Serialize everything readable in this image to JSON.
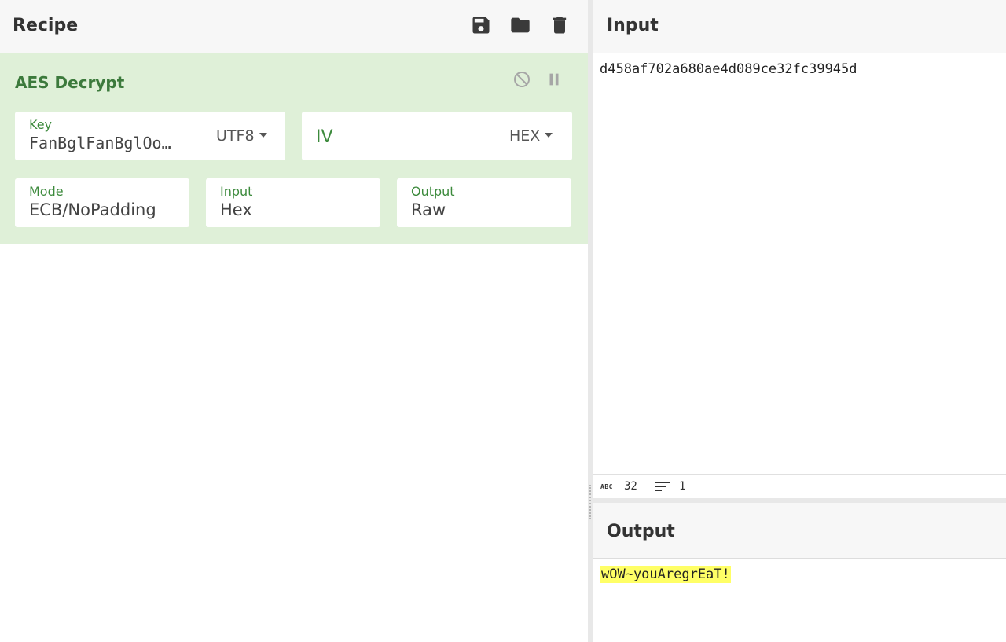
{
  "recipe": {
    "title": "Recipe",
    "icons": [
      "save-icon",
      "folder-icon",
      "trash-icon"
    ]
  },
  "operation": {
    "name": "AES Decrypt",
    "icons": [
      "disable-icon",
      "pause-icon"
    ],
    "key": {
      "label": "Key",
      "value": "FanBglFanBglOo…",
      "encoding": "UTF8"
    },
    "iv": {
      "placeholder": "IV",
      "encoding": "HEX"
    },
    "mode": {
      "label": "Mode",
      "value": "ECB/NoPadding"
    },
    "input": {
      "label": "Input",
      "value": "Hex"
    },
    "output": {
      "label": "Output",
      "value": "Raw"
    }
  },
  "input_pane": {
    "title": "Input",
    "text": "d458af702a680ae4d089ce32fc39945d",
    "status": {
      "abc_label": "ABC",
      "char_count": "32",
      "line_count": "1"
    }
  },
  "output_pane": {
    "title": "Output",
    "text": "wOW~youAregrEaT!"
  },
  "colors": {
    "op_background": "#dff0d8",
    "op_title": "#3c7a3c",
    "highlight": "#ffff66"
  }
}
